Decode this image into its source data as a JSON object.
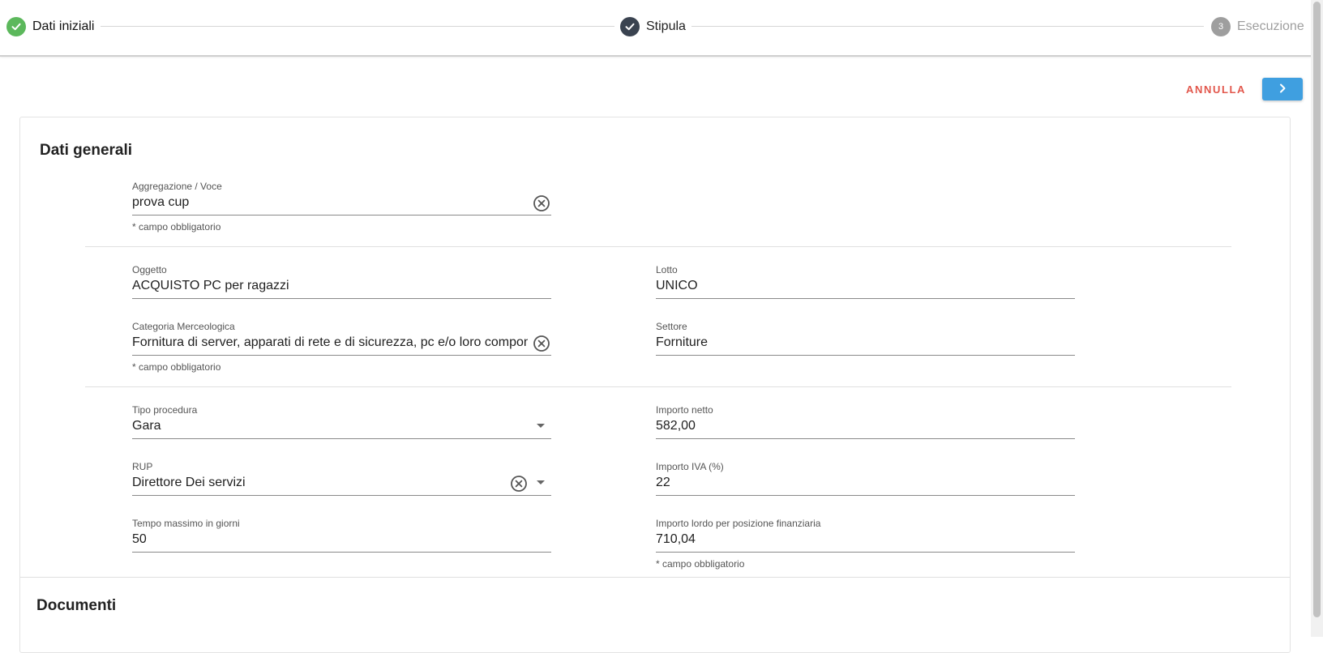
{
  "stepper": {
    "steps": [
      {
        "label": "Dati iniziali",
        "status": "completed",
        "color": "#5cb85c"
      },
      {
        "label": "Stipula",
        "status": "completed",
        "color": "#3a4350"
      },
      {
        "label": "Esecuzione",
        "status": "pending",
        "number": "3",
        "color": "#9e9e9e"
      }
    ]
  },
  "actions": {
    "cancel_label": "ANNULLA",
    "next_icon": "chevron-right-icon",
    "cancel_color": "#e2574c",
    "next_color": "#3f9fe0"
  },
  "general": {
    "title": "Dati generali",
    "aggregazione": {
      "label": "Aggregazione / Voce",
      "value": "prova cup",
      "hint": "* campo obbligatorio"
    },
    "oggetto": {
      "label": "Oggetto",
      "value": "ACQUISTO PC per ragazzi"
    },
    "lotto": {
      "label": "Lotto",
      "value": "UNICO"
    },
    "categoria": {
      "label": "Categoria Merceologica",
      "value": "Fornitura di server, apparati di rete e di sicurezza, pc e/o loro componenti",
      "hint": "* campo obbligatorio"
    },
    "settore": {
      "label": "Settore",
      "value": "Forniture"
    },
    "tipo_procedura": {
      "label": "Tipo procedura",
      "value": "Gara"
    },
    "importo_netto": {
      "label": "Importo netto",
      "value": "582,00"
    },
    "rup": {
      "label": "RUP",
      "value": "Direttore Dei servizi"
    },
    "importo_iva": {
      "label": "Importo IVA (%)",
      "value": "22"
    },
    "tempo_massimo": {
      "label": "Tempo massimo in giorni",
      "value": "50"
    },
    "importo_lordo": {
      "label": "Importo lordo per posizione finanziaria",
      "value": "710,04",
      "hint": "* campo obbligatorio"
    }
  },
  "documents": {
    "title": "Documenti"
  }
}
